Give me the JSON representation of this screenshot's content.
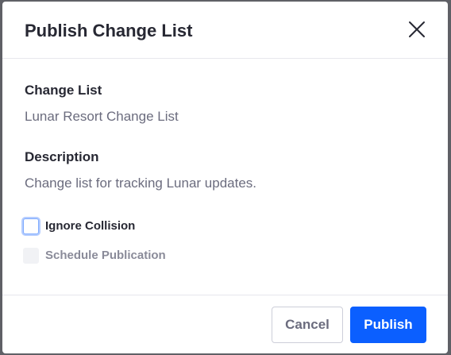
{
  "dialog": {
    "title": "Publish Change List"
  },
  "fields": {
    "change_list_label": "Change List",
    "change_list_value": "Lunar Resort Change List",
    "description_label": "Description",
    "description_value": "Change list for tracking Lunar updates."
  },
  "options": {
    "ignore_collision": {
      "label": "Ignore Collision",
      "checked": false,
      "enabled": true
    },
    "schedule_publication": {
      "label": "Schedule Publication",
      "checked": false,
      "enabled": false
    }
  },
  "footer": {
    "cancel_label": "Cancel",
    "publish_label": "Publish"
  },
  "colors": {
    "primary": "#0b5fff",
    "title_text": "#272833",
    "secondary_text": "#6b6c7e",
    "disabled_text": "#8a8b99",
    "focus_ring": "#80acff"
  },
  "icons": {
    "close": "close-icon"
  }
}
